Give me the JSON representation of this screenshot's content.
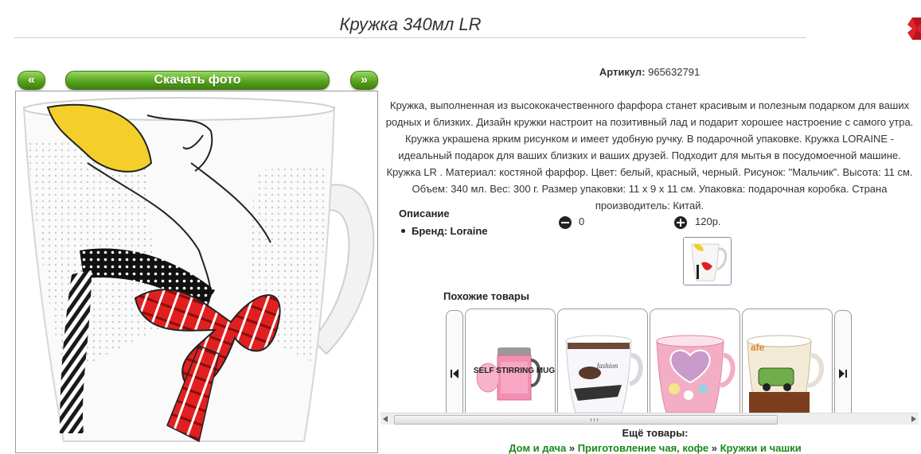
{
  "header": {
    "title": "Кружка 340мл LR"
  },
  "nav": {
    "prev_label": "«",
    "download_label": "Скачать фото",
    "next_label": "»"
  },
  "product": {
    "article_label": "Артикул:",
    "article_value": "965632791",
    "description": "Кружка, выполненная из высококачественного фарфора станет красивым и полезным подарком для ваших родных и близких. Дизайн кружки настроит на позитивный лад и подарит хорошее настроение с самого утра. Кружка украшена ярким рисунком и имеет удобную ручку. В подарочной упаковке. Кружка LORAINE - идеальный подарок для ваших близких и ваших друзей. Подходит для мытья в посудомоечной машине. Кружка LR . Материал: костяной фарфор. Цвет: белый, красный, черный. Рисунок: \"Мальчик\". Высота: 11 см. Объем: 340 мл. Вес: 300 г. Размер упаковки: 11 х 9 х 11 см. Упаковка: подарочная коробка. Страна производитель: Китай.",
    "desc_heading": "Описание",
    "brand_line": "Бренд: Loraine",
    "quantity": "0",
    "price": "120р."
  },
  "similar": {
    "title": "Похожие товары",
    "items": [
      {
        "label": "SELF STIRRING MUG"
      },
      {
        "label": "fashion"
      },
      {
        "label": "heart mug"
      },
      {
        "label": "cafe car mug"
      }
    ]
  },
  "more": {
    "title": "Ещё товары:",
    "breadcrumb": [
      "Дом и дача",
      "Приготовление чая, кофе",
      "Кружки и чашки"
    ],
    "separator": "»"
  },
  "colors": {
    "accent_green": "#58a51b",
    "link_green": "#1a8a1a",
    "close_red": "#e0202a"
  },
  "icons": {
    "close": "close-x-icon",
    "minus": "minus-circle-icon",
    "plus": "plus-circle-icon",
    "carousel_left": "skip-back-icon",
    "carousel_right": "skip-forward-icon"
  }
}
